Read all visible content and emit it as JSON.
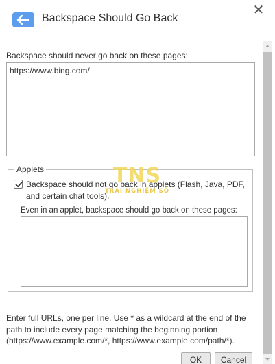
{
  "header": {
    "title": "Backspace Should Go Back",
    "app_icon": "back-arrow-icon",
    "close_glyph": "✕",
    "accent_color": "#5e9ded"
  },
  "main": {
    "never_label": "Backspace should never go back on these pages:",
    "never_value": "https://www.bing.com/",
    "applets": {
      "legend": "Applets",
      "checkbox_checked": true,
      "checkbox_label": "Backspace should not go back in applets (Flash, Java, PDF, and certain chat tools).",
      "even_label": "Even in an applet, backspace should go back on these pages:",
      "even_value": ""
    },
    "help_text": "Enter full URLs, one per line. Use * as a wildcard at the end of the path to include every page matching the beginning portion (https://www.example.com/*, https://www.example.com/path/*)."
  },
  "footer": {
    "ok_label": "OK",
    "cancel_label": "Cancel"
  },
  "watermark": {
    "logo": "TNS",
    "subtitle": "TRẢI NGHIỆM SỐ"
  }
}
